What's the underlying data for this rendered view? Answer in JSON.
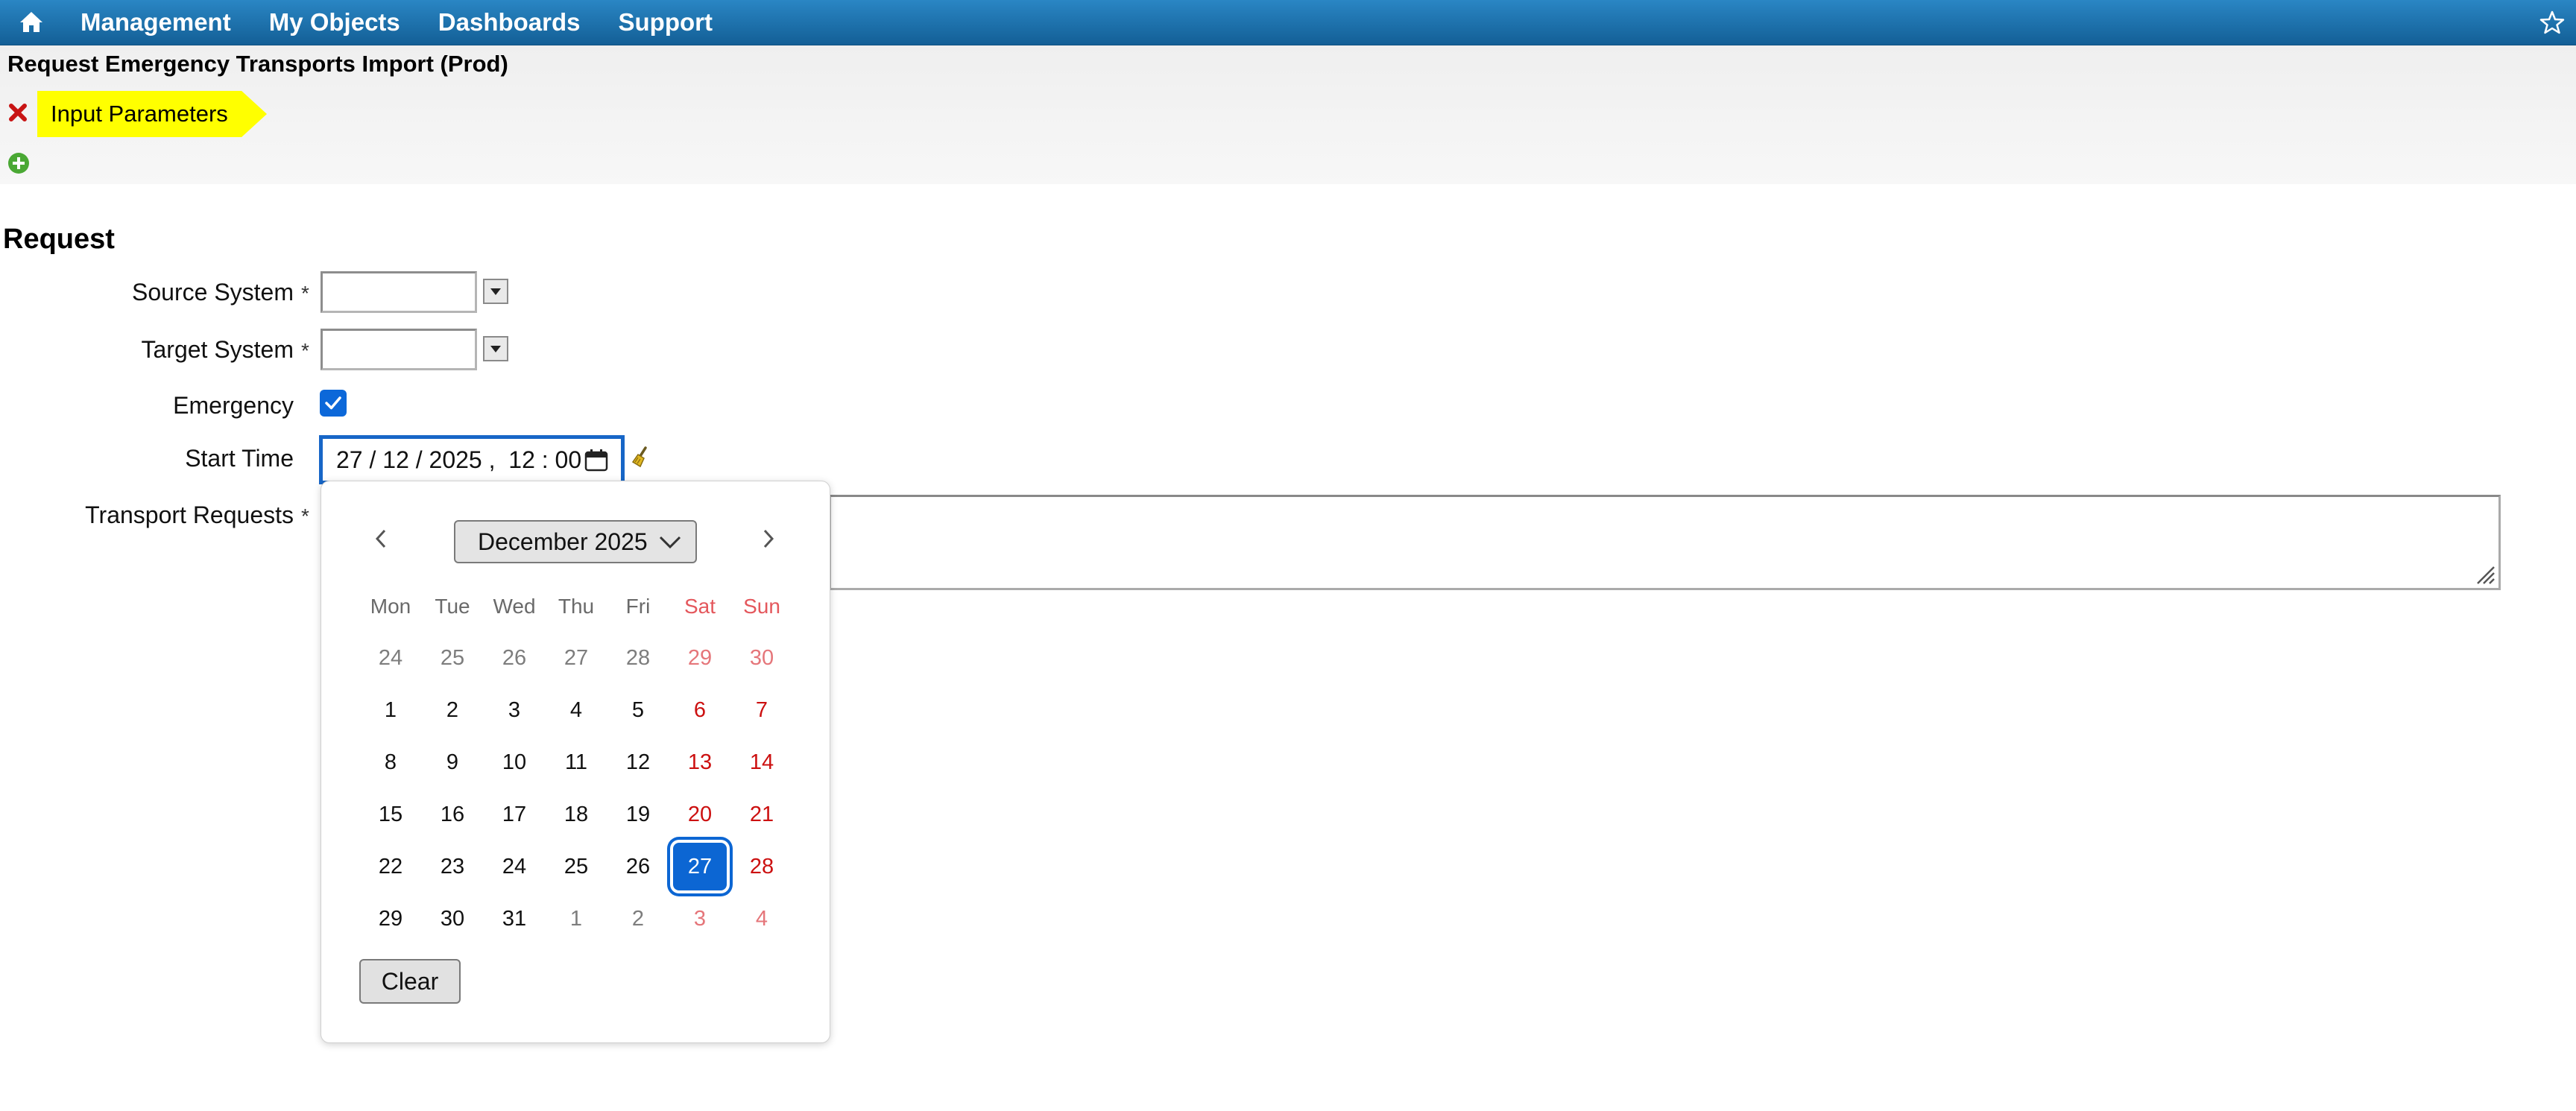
{
  "nav": {
    "home_icon": "home-icon",
    "items": [
      "Management",
      "My Objects",
      "Dashboards",
      "Support"
    ],
    "favorite_icon": "star-icon"
  },
  "header": {
    "title": "Request Emergency Transports Import (Prod)",
    "tag_label": "Input Parameters"
  },
  "form": {
    "section_title": "Request",
    "required_marker": "*",
    "source_system": {
      "label": "Source System",
      "value": ""
    },
    "target_system": {
      "label": "Target System",
      "value": ""
    },
    "emergency": {
      "label": "Emergency",
      "checked": true
    },
    "start_time": {
      "label": "Start Time",
      "value": "27 / 12 / 2025 ,  12 : 00"
    },
    "transport_requests": {
      "label": "Transport Requests",
      "value": ""
    }
  },
  "calendar": {
    "month_label": "December 2025",
    "weekdays": [
      "Mon",
      "Tue",
      "Wed",
      "Thu",
      "Fri",
      "Sat",
      "Sun"
    ],
    "weeks": [
      [
        "24",
        "25",
        "26",
        "27",
        "28",
        "29",
        "30"
      ],
      [
        "1",
        "2",
        "3",
        "4",
        "5",
        "6",
        "7"
      ],
      [
        "8",
        "9",
        "10",
        "11",
        "12",
        "13",
        "14"
      ],
      [
        "15",
        "16",
        "17",
        "18",
        "19",
        "20",
        "21"
      ],
      [
        "22",
        "23",
        "24",
        "25",
        "26",
        "27",
        "28"
      ],
      [
        "29",
        "30",
        "31",
        "1",
        "2",
        "3",
        "4"
      ]
    ],
    "selected_day": "27",
    "clear_label": "Clear",
    "colors": {
      "selected": "#0c66d3",
      "weekend": "#cc1010",
      "accent": "#1766c7"
    }
  }
}
